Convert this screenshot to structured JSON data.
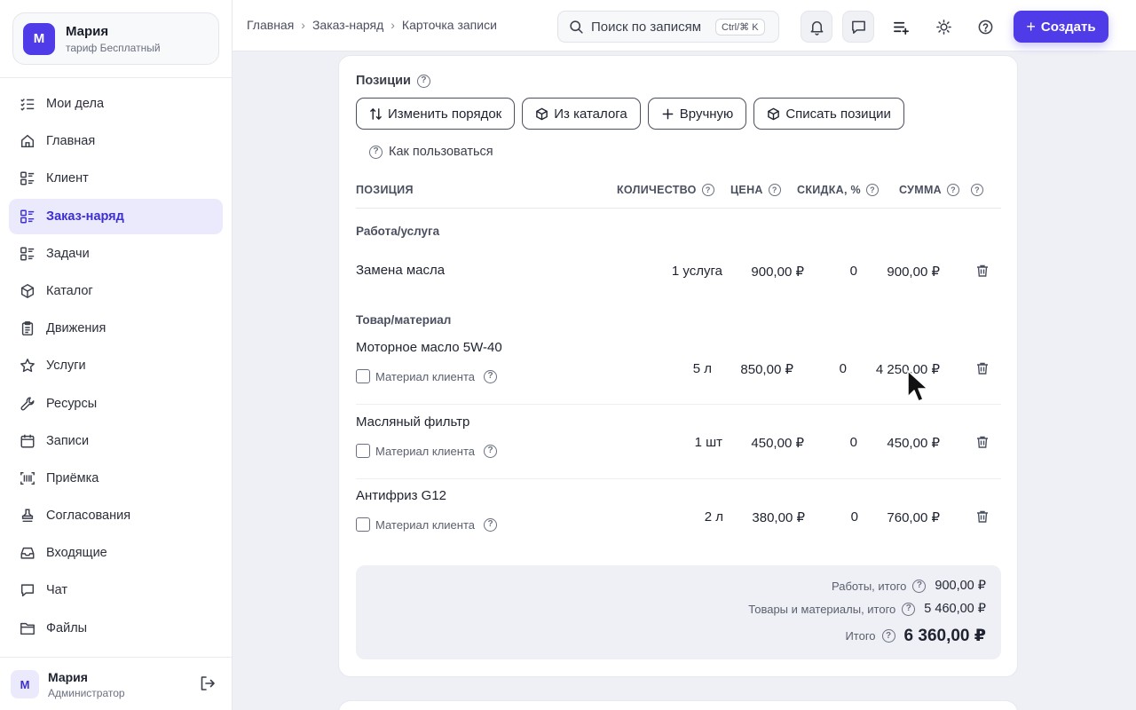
{
  "account": {
    "avatar_letter": "М",
    "name": "Мария",
    "plan": "тариф Бесплатный"
  },
  "nav": {
    "items": [
      {
        "label": "Мои дела",
        "icon": "checklist-icon"
      },
      {
        "label": "Главная",
        "icon": "home-icon"
      },
      {
        "label": "Клиент",
        "icon": "list-icon"
      },
      {
        "label": "Заказ-наряд",
        "icon": "list-icon",
        "active": true
      },
      {
        "label": "Задачи",
        "icon": "list-icon"
      },
      {
        "label": "Каталог",
        "icon": "box-icon"
      },
      {
        "label": "Движения",
        "icon": "clipboard-icon"
      },
      {
        "label": "Услуги",
        "icon": "star-icon"
      },
      {
        "label": "Ресурсы",
        "icon": "wrench-icon"
      },
      {
        "label": "Записи",
        "icon": "calendar-icon"
      },
      {
        "label": "Приёмка",
        "icon": "barcode-icon"
      },
      {
        "label": "Согласования",
        "icon": "stamp-icon"
      },
      {
        "label": "Входящие",
        "icon": "inbox-icon"
      },
      {
        "label": "Чат",
        "icon": "chat-icon"
      },
      {
        "label": "Файлы",
        "icon": "folder-icon"
      }
    ]
  },
  "user": {
    "avatar_letter": "М",
    "name": "Мария",
    "role": "Администратор"
  },
  "breadcrumbs": [
    "Главная",
    "Заказ-наряд",
    "Карточка записи"
  ],
  "search": {
    "placeholder": "Поиск по записям",
    "shortcut": "Ctrl/⌘ K"
  },
  "header": {
    "create_label": "Создать"
  },
  "positions": {
    "title": "Позиции",
    "buttons": {
      "reorder": "Изменить порядок",
      "from_catalog": "Из каталога",
      "manual": "Вручную",
      "write_off": "Списать позиции"
    },
    "howto": "Как пользоваться",
    "columns": {
      "position": "ПОЗИЦИЯ",
      "quantity": "КОЛИЧЕСТВО",
      "price": "ЦЕНА",
      "discount": "СКИДКА, %",
      "sum": "СУММА"
    },
    "client_material_label": "Материал клиента",
    "groups": {
      "services": "Работа/услуга",
      "goods": "Товар/материал"
    },
    "service_rows": [
      {
        "name": "Замена масла",
        "qty": "1 услуга",
        "price": "900,00 ₽",
        "discount": "0",
        "sum": "900,00 ₽"
      }
    ],
    "goods_rows": [
      {
        "name": "Моторное масло 5W-40",
        "qty": "5 л",
        "price": "850,00 ₽",
        "discount": "0",
        "sum": "4 250,00 ₽"
      },
      {
        "name": "Масляный фильтр",
        "qty": "1 шт",
        "price": "450,00 ₽",
        "discount": "0",
        "sum": "450,00 ₽"
      },
      {
        "name": "Антифриз G12",
        "qty": "2 л",
        "price": "380,00 ₽",
        "discount": "0",
        "sum": "760,00 ₽"
      }
    ],
    "totals": {
      "works_label": "Работы, итого",
      "works_value": "900,00 ₽",
      "goods_label": "Товары и материалы, итого",
      "goods_value": "5 460,00 ₽",
      "total_label": "Итого",
      "total_value": "6 360,00 ₽"
    }
  },
  "colors": {
    "accent": "#4f3be8",
    "active_bg": "#ebeafd",
    "background": "#eef0f5"
  }
}
